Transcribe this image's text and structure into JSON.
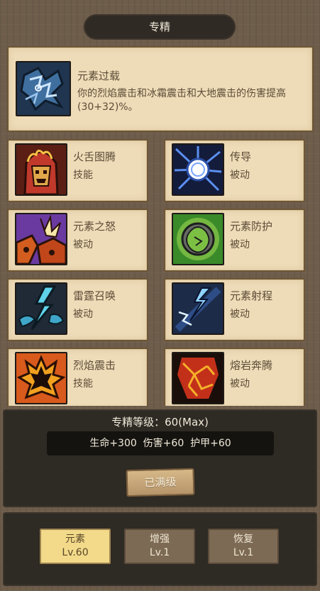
{
  "header": {
    "title": "专精"
  },
  "featured": {
    "name": "元素过载",
    "desc": "你的烈焰震击和冰霜震击和大地震击的伤害提高(30+32)%。",
    "icon": "lightning-chains-icon"
  },
  "skills": [
    {
      "name": "火舌图腾",
      "type": "技能",
      "icon": "flame-totem-icon"
    },
    {
      "name": "传导",
      "type": "被动",
      "icon": "conduction-orb-icon"
    },
    {
      "name": "元素之怒",
      "type": "被动",
      "icon": "elemental-fury-icon"
    },
    {
      "name": "元素防护",
      "type": "被动",
      "icon": "elemental-shield-icon"
    },
    {
      "name": "雷霆召唤",
      "type": "被动",
      "icon": "thunder-call-icon"
    },
    {
      "name": "元素射程",
      "type": "被动",
      "icon": "elemental-range-icon"
    },
    {
      "name": "烈焰震击",
      "type": "技能",
      "icon": "flame-shock-icon"
    },
    {
      "name": "熔岩奔腾",
      "type": "被动",
      "icon": "lava-surge-icon"
    }
  ],
  "mastery": {
    "level_text": "专精等级：60(Max)",
    "stats_text": "生命+300  伤害+60  护甲+60",
    "maxed_button": "已满级"
  },
  "tabs": [
    {
      "name": "元素",
      "level": "Lv.60",
      "active": true
    },
    {
      "name": "增强",
      "level": "Lv.1",
      "active": false
    },
    {
      "name": "恢复",
      "level": "Lv.1",
      "active": false
    }
  ],
  "colors": {
    "parchment": "#eedcb8",
    "panel_dark": "#2e2a24",
    "tab_active": "#f2da8a",
    "tab_inactive": "#7c6a55",
    "text_brown": "#5d4b38"
  }
}
